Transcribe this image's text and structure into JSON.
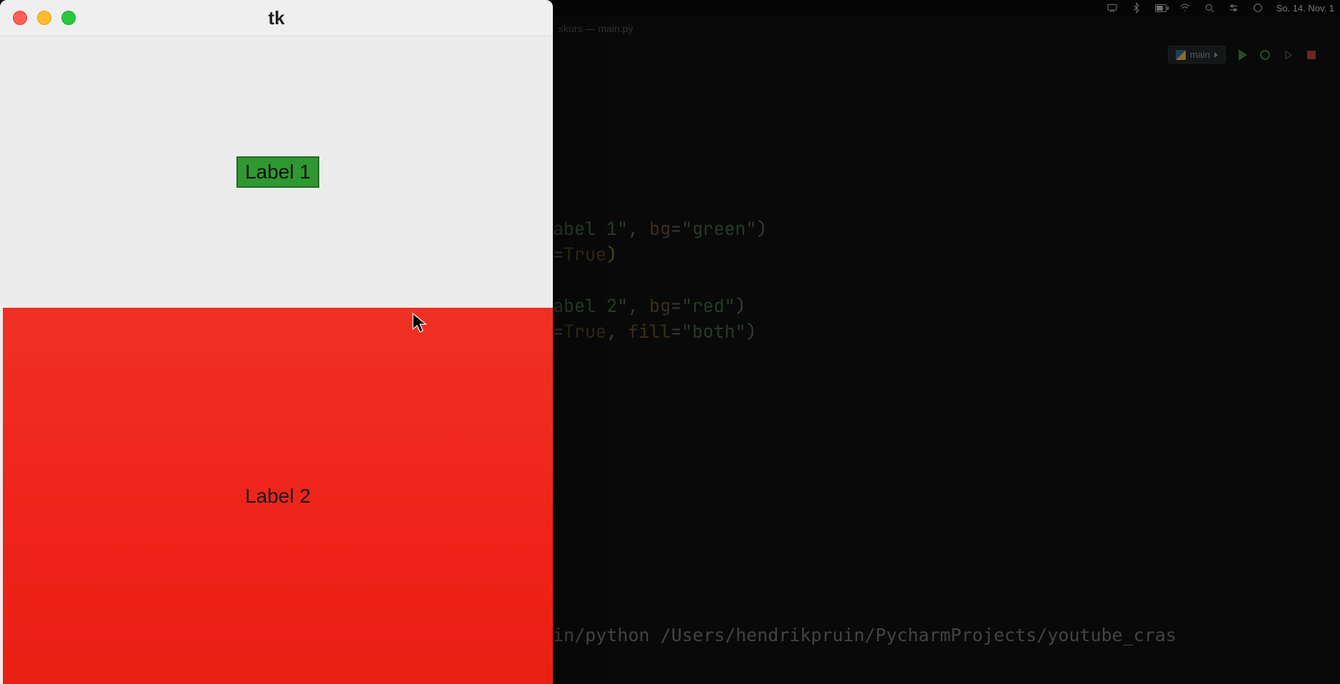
{
  "menubar": {
    "date": "So. 14. Nov. 1"
  },
  "ide": {
    "tab_title": "skurs — main.py",
    "run_config": "main",
    "code": {
      "line1_str": "abel 1\"",
      "line1_kw": "bg",
      "line1_val": "\"green\"",
      "line2_val": "True",
      "line3_str": "abel 2\"",
      "line3_kw": "bg",
      "line3_val": "\"red\"",
      "line4_val1": "True",
      "line4_kw2": "fill",
      "line4_val2": "\"both\""
    },
    "terminal": "in/python /Users/hendrikpruin/PycharmProjects/youtube_cras"
  },
  "tk": {
    "title": "tk",
    "label1": "Label 1",
    "label2": "Label 2"
  }
}
